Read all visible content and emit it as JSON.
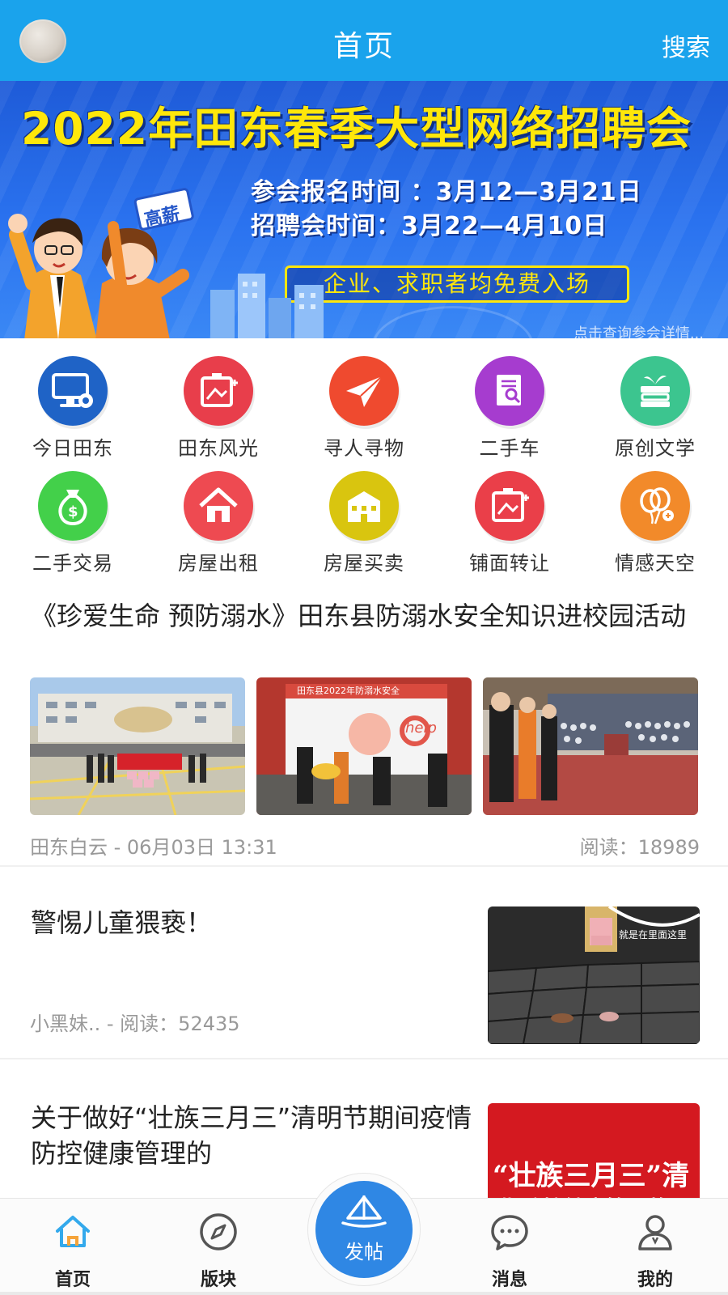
{
  "header": {
    "title": "首页",
    "search_label": "搜索"
  },
  "banner": {
    "headline": "2022年田东春季大型网络招聘会",
    "line1": "参会报名时间 ：3月12—3月21日",
    "line2": "招聘会时间：3月22—4月10日",
    "pill": "企业、求职者均免费入场",
    "sign": "高薪",
    "hint": "点击查询参会详情..."
  },
  "categories": [
    {
      "label": "今日田东",
      "color": "#1f63c6",
      "icon": "monitor-gear-icon"
    },
    {
      "label": "田东风光",
      "color": "#e83e4b",
      "icon": "picture-frame-icon"
    },
    {
      "label": "寻人寻物",
      "color": "#ef4a2f",
      "icon": "paper-plane-icon"
    },
    {
      "label": "二手车",
      "color": "#a63ccf",
      "icon": "document-search-icon"
    },
    {
      "label": "原创文学",
      "color": "#3cc58f",
      "icon": "books-plant-icon"
    },
    {
      "label": "二手交易",
      "color": "#43d04a",
      "icon": "money-bag-icon"
    },
    {
      "label": "房屋出租",
      "color": "#ee4a51",
      "icon": "house-icon"
    },
    {
      "label": "房屋买卖",
      "color": "#d9c50f",
      "icon": "building-icon"
    },
    {
      "label": "铺面转让",
      "color": "#ea3f49",
      "icon": "shop-frame-icon"
    },
    {
      "label": "情感天空",
      "color": "#f28a2a",
      "icon": "balloons-icon"
    }
  ],
  "posts": [
    {
      "title": "《珍爱生命 预防溺水》田东县防溺水安全知识进校园活动",
      "meta_left": "田东白云 - 06月03日 13:31",
      "meta_right": "阅读：18989",
      "photo2_caption": "田东县2022年防溺水安全",
      "photo2_word": "help"
    },
    {
      "title": "警惕儿童猥亵！",
      "meta": "小黑妹.. - 阅读：52435",
      "photo_caption": "就是在里面这里"
    },
    {
      "title": "关于做好“壮族三月三”清明节期间疫情防控健康管理的",
      "photo_line1": "“壮族三月三”清",
      "photo_line2": "期防控健康管理的通"
    }
  ],
  "tabbar": {
    "home": "首页",
    "sections": "版块",
    "post": "发帖",
    "messages": "消息",
    "mine": "我的"
  },
  "colors": {
    "header_bg": "#1aa3ec",
    "tab_active": "#33a9ec",
    "post_button": "#2f87e4"
  }
}
